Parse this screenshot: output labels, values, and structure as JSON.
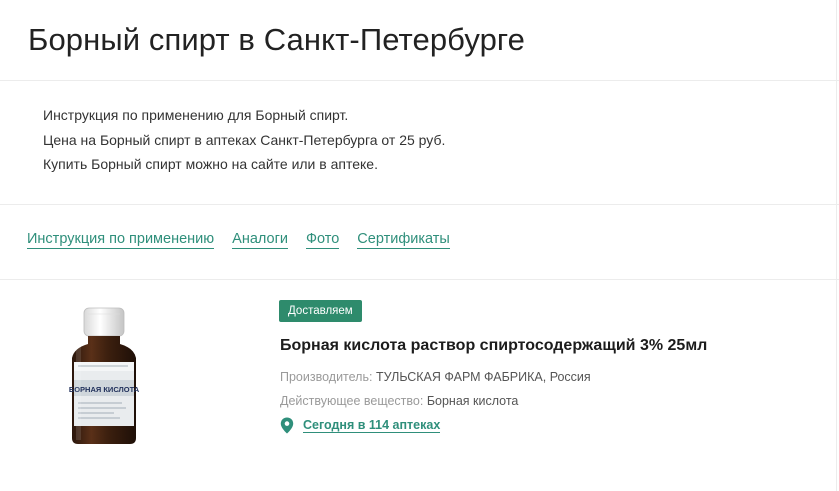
{
  "page": {
    "title": "Борный спирт в Санкт-Петербурге"
  },
  "intro": {
    "lines": [
      "Инструкция по применению для Борный спирт.",
      "Цена на Борный спирт в аптеках Санкт-Петербурга от 25 руб.",
      "Купить Борный спирт можно на сайте или в аптеке."
    ]
  },
  "tabs": [
    {
      "label": "Инструкция по применению"
    },
    {
      "label": "Аналоги"
    },
    {
      "label": "Фото"
    },
    {
      "label": "Сертификаты"
    }
  ],
  "product": {
    "badge": "Доставляем",
    "name": "Борная кислота раствор спиртосодержащий 3% 25мл",
    "manufacturer_label": "Производитель:",
    "manufacturer_value": "ТУЛЬСКАЯ ФАРМ ФАБРИКА, Россия",
    "substance_label": "Действующее вещество:",
    "substance_value": "Борная кислота",
    "availability": "Сегодня в 114 аптеках",
    "image_label_text": "БОРНАЯ КИСЛОТА",
    "availability_icon": "location-pin-icon"
  },
  "colors": {
    "accent": "#2f8f7b",
    "badge_bg": "#2e8b6c"
  }
}
